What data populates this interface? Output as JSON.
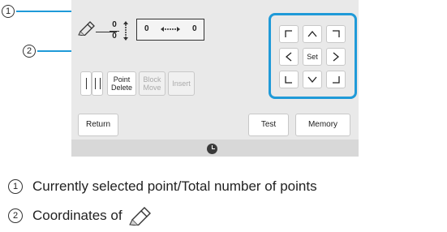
{
  "callouts": [
    "1",
    "2"
  ],
  "pointer": {
    "current": "0",
    "total": "0"
  },
  "coordinates": {
    "x": "0",
    "y": "0"
  },
  "buttons": {
    "point_delete": "Point Delete",
    "block_move": "Block Move",
    "insert": "Insert",
    "return": "Return",
    "test": "Test",
    "memory": "Memory",
    "set": "Set"
  },
  "legend": [
    {
      "num": "1",
      "text": "Currently selected point/Total number of points"
    },
    {
      "num": "2",
      "text": "Coordinates of"
    }
  ],
  "colors": {
    "callout_line": "#1f9ad8",
    "screen_bg": "#e9e9e9"
  },
  "icons": [
    "pen-icon",
    "updown-arrow-icon",
    "left-right-arrow-icon",
    "clock-icon"
  ]
}
